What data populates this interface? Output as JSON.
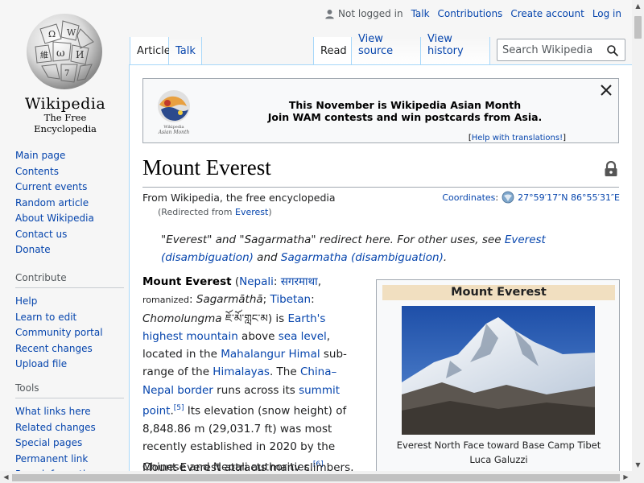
{
  "logo": {
    "wordmark": "Wikipedia",
    "tagline": "The Free Encyclopedia"
  },
  "personal": {
    "status": "Not logged in",
    "links": [
      "Talk",
      "Contributions",
      "Create account",
      "Log in"
    ]
  },
  "tabs": {
    "left": [
      "Article",
      "Talk"
    ],
    "right": [
      "Read",
      "View source",
      "View history"
    ],
    "selected": [
      "Article",
      "Read"
    ]
  },
  "search": {
    "placeholder": "Search Wikipedia",
    "value": ""
  },
  "sidebar": {
    "main": [
      "Main page",
      "Contents",
      "Current events",
      "Random article",
      "About Wikipedia",
      "Contact us",
      "Donate"
    ],
    "contribute": {
      "heading": "Contribute",
      "items": [
        "Help",
        "Learn to edit",
        "Community portal",
        "Recent changes",
        "Upload file"
      ]
    },
    "tools": {
      "heading": "Tools",
      "items": [
        "What links here",
        "Related changes",
        "Special pages",
        "Permanent link",
        "Page information"
      ]
    }
  },
  "banner": {
    "line1": "This November is Wikipedia Asian Month",
    "line2": "Join WAM contests and win postcards from Asia.",
    "help_open": "[",
    "help_link": "Help with translations!",
    "help_close": "]",
    "logo_caption1": "Wikipedia",
    "logo_caption2": "Asian Month"
  },
  "article": {
    "title": "Mount Everest",
    "from": "From Wikipedia, the free encyclopedia",
    "redirect_prefix": "(Redirected from ",
    "redirect_link": "Everest",
    "redirect_suffix": ")",
    "coords_label": "Coordinates",
    "coords_colon": ":",
    "coords_value": "27°59′17″N 86°55′31″E",
    "hatnote": {
      "t1": "\"Everest\" and \"Sagarmatha\" redirect here. For other uses, see ",
      "l1": "Everest (disambiguation)",
      "t2": " and ",
      "l2": "Sagarmatha (disambiguation)",
      "t3": "."
    },
    "lead": {
      "bold": "Mount Everest",
      "p1": " (",
      "nepali": "Nepali",
      "p2": ": ",
      "nepali_script": "सगरमाथा",
      "p3": ", ",
      "romanized": "romanized",
      "p4": ": ",
      "sagarmatha": "Sagarmāthā",
      "p5": "; ",
      "tibetan": "Tibetan",
      "p6": ": ",
      "chomolungma": "Chomolungma",
      "p7": " ",
      "tibetan_script": "ཇོ་མོ་གླང་མ",
      "p8": ") is ",
      "highest": "Earth's highest mountain",
      "p9": " above ",
      "sea": "sea level",
      "p10": ", located in the ",
      "himal": "Mahalangur Himal",
      "p11": " sub-range of the ",
      "himalayas": "Himalayas",
      "p12": ". The ",
      "border": "China–Nepal border",
      "p13": " runs across its ",
      "summit": "summit point",
      "p14": ".",
      "ref5": "[5]",
      "p15": " Its elevation (snow height) of 8,848.86 m (29,031.7 ft) was most recently established in 2020 by the Chinese and Nepali authorities.",
      "ref6": "[6]"
    },
    "second": "Mount Everest attracts many climbers,"
  },
  "infobox": {
    "title": "Mount Everest",
    "caption": "Everest North Face toward Base Camp Tibet Luca Galuzzi"
  },
  "colors": {
    "link": "#0645ad",
    "infobox_title_bg": "#f1dfc0",
    "tab_border": "#a7d7f9"
  }
}
